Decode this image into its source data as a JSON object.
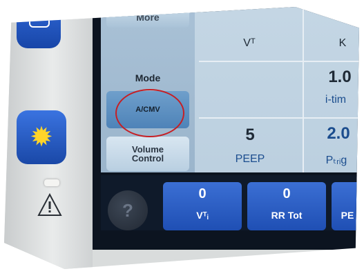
{
  "menu": {
    "more_label": "More",
    "mode_label": "Mode",
    "mode_value": "A/CMV",
    "volume_line1": "Volume",
    "volume_line2": "Control"
  },
  "params": {
    "vt_label": "Vᵀ",
    "k_label": "K",
    "itime_value": "1.0",
    "itime_label": "i-tim",
    "peep_value": "5",
    "peep_label": "PEEP",
    "ptrig_value": "2.0",
    "ptrig_label": "Pₜᵣᵢg"
  },
  "bottom": {
    "help_icon": "question-mark-icon",
    "tiles": [
      {
        "value": "0",
        "label": "Vᵀᵢ"
      },
      {
        "value": "0",
        "label": "RR Tot"
      },
      {
        "value": "",
        "label": "PE"
      }
    ]
  },
  "annotation": {
    "circle_color": "#c61f24"
  },
  "colors": {
    "side_button_blue": "#1f4fb4",
    "sun_yellow": "#ffd42a"
  }
}
